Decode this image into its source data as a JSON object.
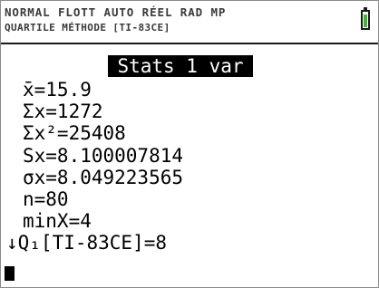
{
  "status_bar": {
    "line1": "NORMAL FLOTT AUTO RÉEL RAD MP",
    "line2": "QUARTILE MÉTHODE [TI-83CE]",
    "battery_color": "#3fb833",
    "battery_level": 0.85
  },
  "screen": {
    "title": "Stats 1 var",
    "results": [
      "x̄=15.9",
      "Σx=1272",
      "Σx²=25408",
      "Sx=8.100007814",
      "σx=8.049223565",
      "n=80",
      "minX=4",
      "↓Q₁[TI-83CE]=8"
    ]
  }
}
